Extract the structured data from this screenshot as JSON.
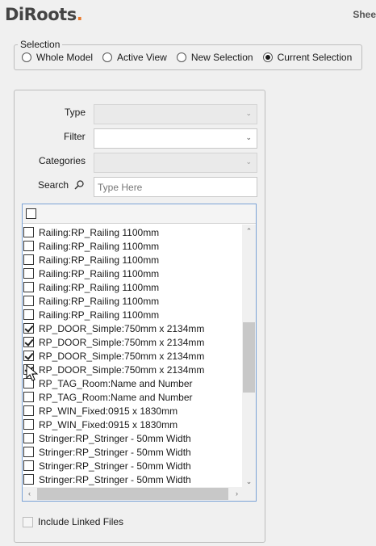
{
  "app": {
    "logo_text": "DiRoots",
    "title": "Shee"
  },
  "selection": {
    "legend": "Selection",
    "options": [
      {
        "label": "Whole Model",
        "checked": false
      },
      {
        "label": "Active View",
        "checked": false
      },
      {
        "label": "New Selection",
        "checked": false
      },
      {
        "label": "Current Selection",
        "checked": true
      }
    ]
  },
  "filters": {
    "type_label": "Type",
    "filter_label": "Filter",
    "categories_label": "Categories",
    "search_label": "Search",
    "search_placeholder": "Type Here"
  },
  "list": {
    "items": [
      {
        "label": "Railing:RP_Railing 1100mm",
        "checked": false
      },
      {
        "label": "Railing:RP_Railing 1100mm",
        "checked": false
      },
      {
        "label": "Railing:RP_Railing 1100mm",
        "checked": false
      },
      {
        "label": "Railing:RP_Railing 1100mm",
        "checked": false
      },
      {
        "label": "Railing:RP_Railing 1100mm",
        "checked": false
      },
      {
        "label": "Railing:RP_Railing 1100mm",
        "checked": false
      },
      {
        "label": "Railing:RP_Railing 1100mm",
        "checked": false
      },
      {
        "label": "RP_DOOR_Simple:750mm x 2134mm",
        "checked": true
      },
      {
        "label": "RP_DOOR_Simple:750mm x 2134mm",
        "checked": true
      },
      {
        "label": "RP_DOOR_Simple:750mm x 2134mm",
        "checked": true
      },
      {
        "label": "RP_DOOR_Simple:750mm x 2134mm",
        "checked": true
      },
      {
        "label": "RP_TAG_Room:Name and Number",
        "checked": false
      },
      {
        "label": "RP_TAG_Room:Name and Number",
        "checked": false
      },
      {
        "label": "RP_WIN_Fixed:0915 x 1830mm",
        "checked": false
      },
      {
        "label": "RP_WIN_Fixed:0915 x 1830mm",
        "checked": false
      },
      {
        "label": "Stringer:RP_Stringer - 50mm Width",
        "checked": false
      },
      {
        "label": "Stringer:RP_Stringer - 50mm Width",
        "checked": false
      },
      {
        "label": "Stringer:RP_Stringer - 50mm Width",
        "checked": false
      },
      {
        "label": "Stringer:RP_Stringer - 50mm Width",
        "checked": false
      }
    ]
  },
  "include_linked": {
    "label": "Include Linked Files",
    "checked": false
  }
}
